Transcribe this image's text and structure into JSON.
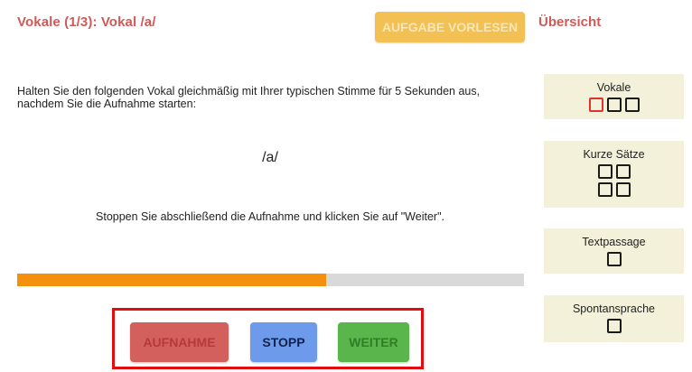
{
  "header": {
    "title": "Vokale (1/3): Vokal /a/",
    "read_aloud_label": "AUFGABE VORLESEN",
    "overview_title": "Übersicht"
  },
  "task": {
    "instruction": "Halten Sie den folgenden Vokal gleichmäßig mit Ihrer typischen Stimme für 5 Sekunden aus, nachdem Sie die Aufnahme starten:",
    "vowel": "/a/",
    "stop_instruction": "Stoppen Sie abschließend die Aufnahme und klicken Sie auf \"Weiter\"."
  },
  "progress": {
    "value": 0.61,
    "color": "#f5900f"
  },
  "controls": {
    "record_label": "AUFNAHME",
    "stop_label": "STOPP",
    "next_label": "WEITER"
  },
  "overview": {
    "items": [
      {
        "label": "Vokale",
        "count": 3,
        "active_index": 0
      },
      {
        "label": "Kurze Sätze",
        "count": 4
      },
      {
        "label": "Textpassage",
        "count": 1
      },
      {
        "label": "Spontansprache",
        "count": 1
      }
    ]
  },
  "colors": {
    "title": "#d05a57",
    "read_button": "#f2c053",
    "record_button": "#d4605e",
    "stop_button": "#6d9aea",
    "next_button": "#5ab54c",
    "highlight_box": "#e40d0d",
    "card_bg": "#f3f1da"
  }
}
